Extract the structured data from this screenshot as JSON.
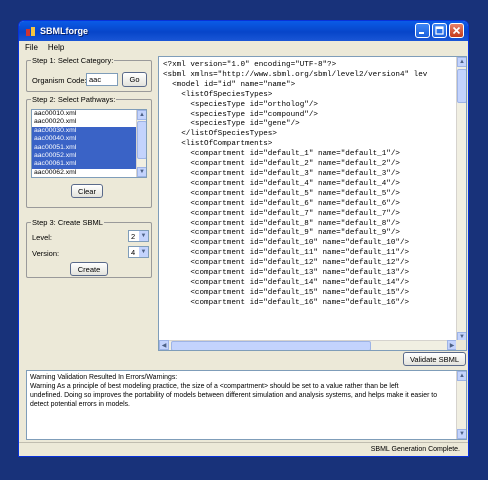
{
  "window": {
    "title": "SBMLforge",
    "controls": {
      "minimize": "minimize",
      "maximize": "maximize",
      "close": "close"
    }
  },
  "menu": {
    "file": "File",
    "help": "Help"
  },
  "step1": {
    "title": "Step 1: Select Category:",
    "organism_label": "Organism Code:",
    "organism_value": "aac",
    "go_label": "Go"
  },
  "step2": {
    "title": "Step 2: Select Pathways:",
    "items": [
      {
        "label": "aac00010.xml",
        "selected": false
      },
      {
        "label": "aac00020.xml",
        "selected": false
      },
      {
        "label": "aac00030.xml",
        "selected": true
      },
      {
        "label": "aac00040.xml",
        "selected": true
      },
      {
        "label": "aac00051.xml",
        "selected": true
      },
      {
        "label": "aac00052.xml",
        "selected": true
      },
      {
        "label": "aac00061.xml",
        "selected": true
      },
      {
        "label": "aac00062.xml",
        "selected": false
      }
    ],
    "clear_label": "Clear"
  },
  "step3": {
    "title": "Step 3: Create SBML",
    "level_label": "Level:",
    "level_value": "2",
    "version_label": "Version:",
    "version_value": "4",
    "create_label": "Create"
  },
  "xml": {
    "lines": [
      "<?xml version=\"1.0\" encoding=\"UTF-8\"?>",
      "<sbml xmlns=\"http://www.sbml.org/sbml/level2/version4\" lev",
      "  <model id=\"id\" name=\"name\">",
      "    <listOfSpeciesTypes>",
      "      <speciesType id=\"ortholog\"/>",
      "      <speciesType id=\"compound\"/>",
      "      <speciesType id=\"gene\"/>",
      "    </listOfSpeciesTypes>",
      "    <listOfCompartments>",
      "      <compartment id=\"default_1\" name=\"default_1\"/>",
      "      <compartment id=\"default_2\" name=\"default_2\"/>",
      "      <compartment id=\"default_3\" name=\"default_3\"/>",
      "      <compartment id=\"default_4\" name=\"default_4\"/>",
      "      <compartment id=\"default_5\" name=\"default_5\"/>",
      "      <compartment id=\"default_6\" name=\"default_6\"/>",
      "      <compartment id=\"default_7\" name=\"default_7\"/>",
      "      <compartment id=\"default_8\" name=\"default_8\"/>",
      "      <compartment id=\"default_9\" name=\"default_9\"/>",
      "      <compartment id=\"default_10\" name=\"default_10\"/>",
      "      <compartment id=\"default_11\" name=\"default_11\"/>",
      "      <compartment id=\"default_12\" name=\"default_12\"/>",
      "      <compartment id=\"default_13\" name=\"default_13\"/>",
      "      <compartment id=\"default_14\" name=\"default_14\"/>",
      "      <compartment id=\"default_15\" name=\"default_15\"/>",
      "      <compartment id=\"default_16\" name=\"default_16\"/>"
    ],
    "validate_label": "Validate SBML"
  },
  "messages": {
    "line1": "Warning          Validation Resulted In Errors/Warnings:",
    "line2": "Warning          As a principle of best modeling practice, the size of a <compartment> should be set to a value rather than be left",
    "line3": "undefined. Doing so improves the portability of models between different simulation and analysis systems, and helps make it easier to",
    "line4": "detect potential errors in models."
  },
  "status": {
    "text": "SBML Generation Complete."
  }
}
